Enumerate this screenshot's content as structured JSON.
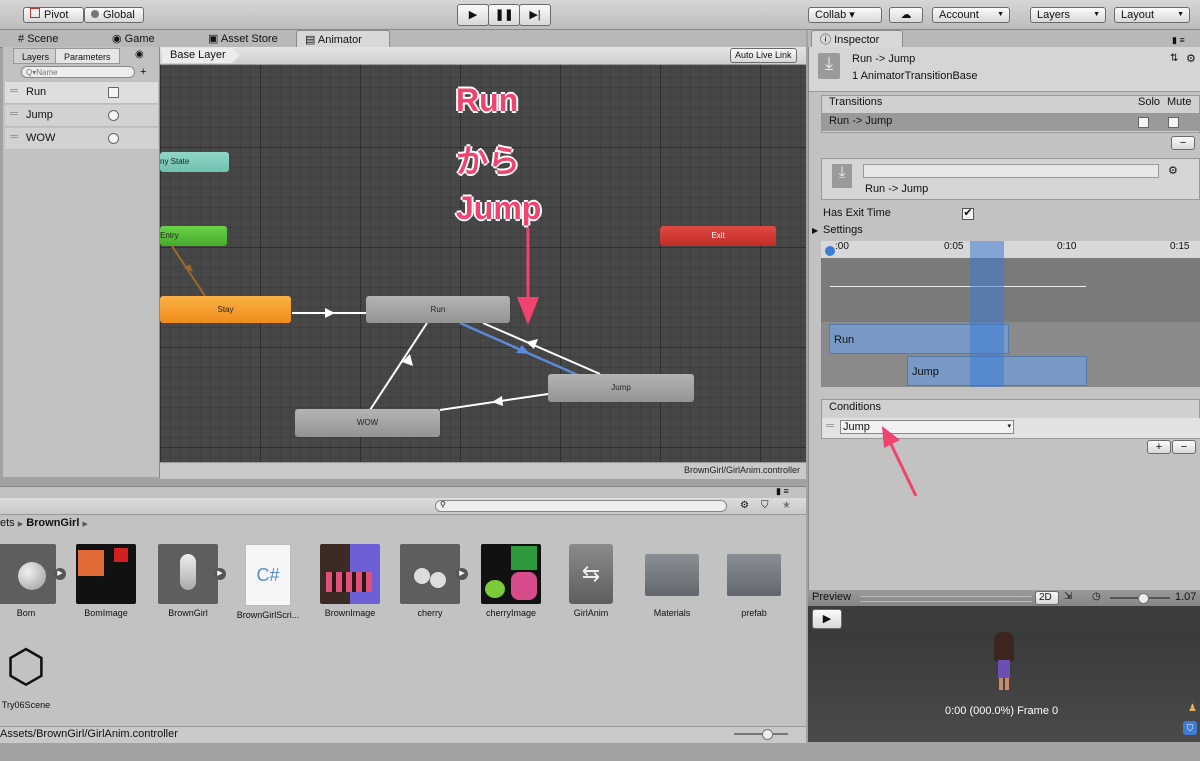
{
  "toolbar": {
    "pivot": "Pivot",
    "global": "Global",
    "collab": "Collab ▾",
    "account": "Account",
    "layers": "Layers",
    "layout": "Layout"
  },
  "tabs": {
    "scene": "Scene",
    "game": "Game",
    "asset_store": "Asset Store",
    "animator": "Animator"
  },
  "animator": {
    "left_tabs": {
      "layers": "Layers",
      "parameters": "Parameters"
    },
    "search_placeholder": "Q▾Name",
    "parameters": [
      {
        "name": "Run",
        "type": "bool"
      },
      {
        "name": "Jump",
        "type": "trigger"
      },
      {
        "name": "WOW",
        "type": "trigger"
      }
    ],
    "breadcrumb": "Base Layer",
    "auto_live_link": "Auto Live Link",
    "nodes": {
      "any_state": "ny State",
      "entry": "Entry",
      "exit": "Exit",
      "stay": "Stay",
      "run": "Run",
      "jump": "Jump",
      "wow": "WOW"
    },
    "annotation": [
      "Run",
      "から",
      "Jump"
    ],
    "footer_path": "BrownGirl/GirlAnim.controller"
  },
  "project": {
    "breadcrumb_prefix": "ets",
    "breadcrumb_folder": "BrownGirl",
    "assets": [
      "Bom",
      "BomImage",
      "BrownGirl",
      "BrownGirlScri...",
      "BrownImage",
      "cherry",
      "cherryImage",
      "GirlAnim",
      "Materials",
      "prefab",
      "Try06Scene"
    ],
    "footer_path": "Assets/BrownGirl/GirlAnim.controller"
  },
  "inspector": {
    "tab": "Inspector",
    "title": "Run -> Jump",
    "subtitle": "1 AnimatorTransitionBase",
    "transitions_header": "Transitions",
    "solo": "Solo",
    "mute": "Mute",
    "transition_row": "Run -> Jump",
    "name_value": "",
    "transition_name": "Run -> Jump",
    "has_exit_time_label": "Has Exit Time",
    "has_exit_time": true,
    "settings_label": "Settings",
    "timeline_ticks": [
      ":00",
      "0:05",
      "0:10",
      "0:15"
    ],
    "timeline_run": "Run",
    "timeline_jump": "Jump",
    "conditions_header": "Conditions",
    "condition_param": "Jump"
  },
  "preview": {
    "label": "Preview",
    "mode_2d": "2D",
    "speed": "1.07",
    "status": "0:00 (000.0%) Frame 0"
  },
  "colors": {
    "accent_pink": "#f0436e",
    "selection_blue": "#3d7bd5"
  }
}
